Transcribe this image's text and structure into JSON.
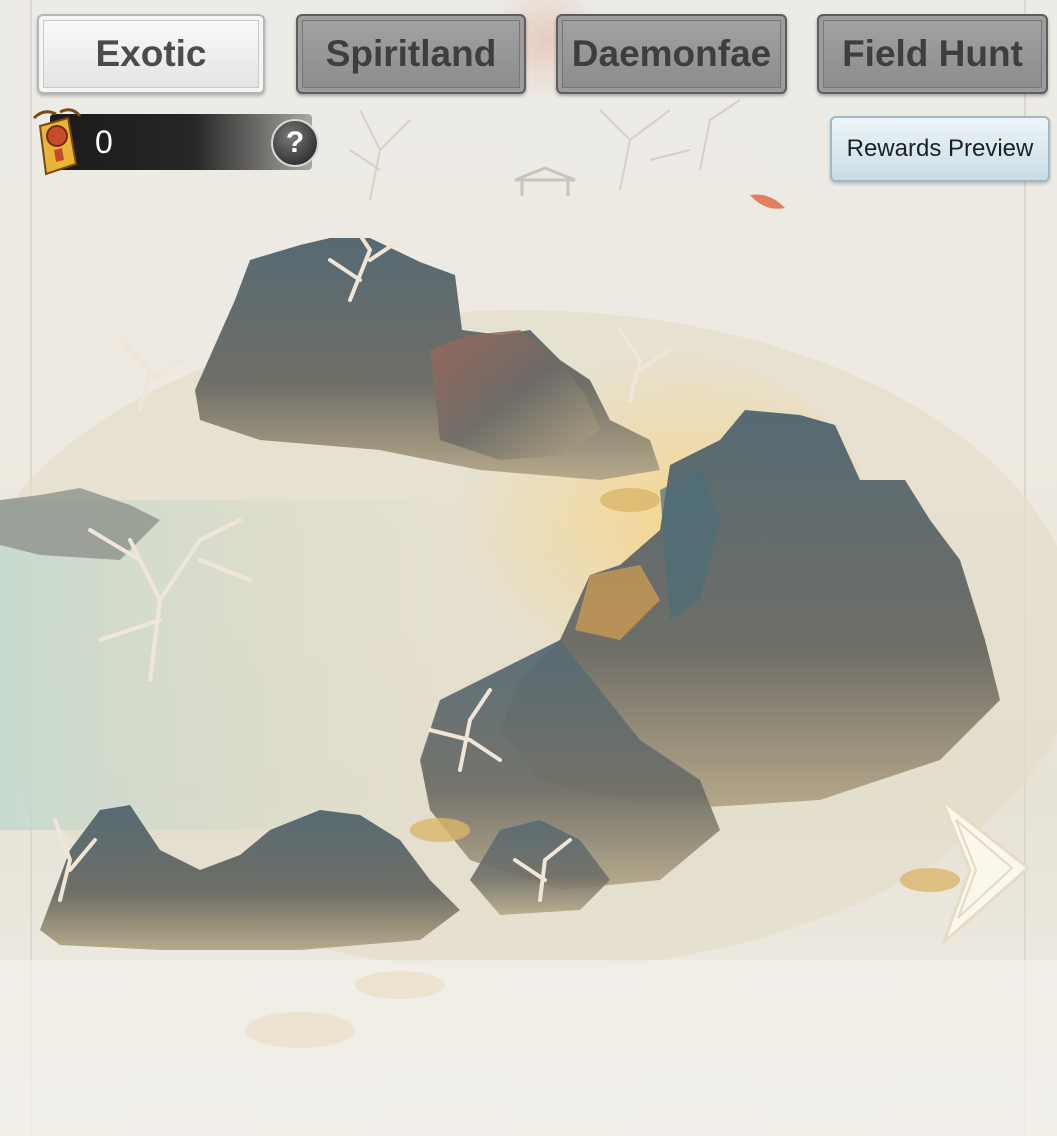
{
  "tabs": [
    {
      "label": "Exotic",
      "active": true
    },
    {
      "label": "Spiritland",
      "active": false
    },
    {
      "label": "Daemonfae",
      "active": false
    },
    {
      "label": "Field Hunt",
      "active": false
    }
  ],
  "currency": {
    "value": "0",
    "icon": "talisman-token-icon"
  },
  "help": {
    "glyph": "?",
    "icon": "help-icon"
  },
  "rewards_preview": {
    "label": "Rewards Preview"
  },
  "navigation": {
    "next_icon": "chevron-right-icon"
  },
  "colors": {
    "active_tab": "#eeeeee",
    "inactive_tab": "#989898",
    "rewards_button": "#d6e7ee",
    "mountain": "#5f6a6e",
    "mist": "#e8e1cf",
    "highlight": "#f0b64a"
  }
}
